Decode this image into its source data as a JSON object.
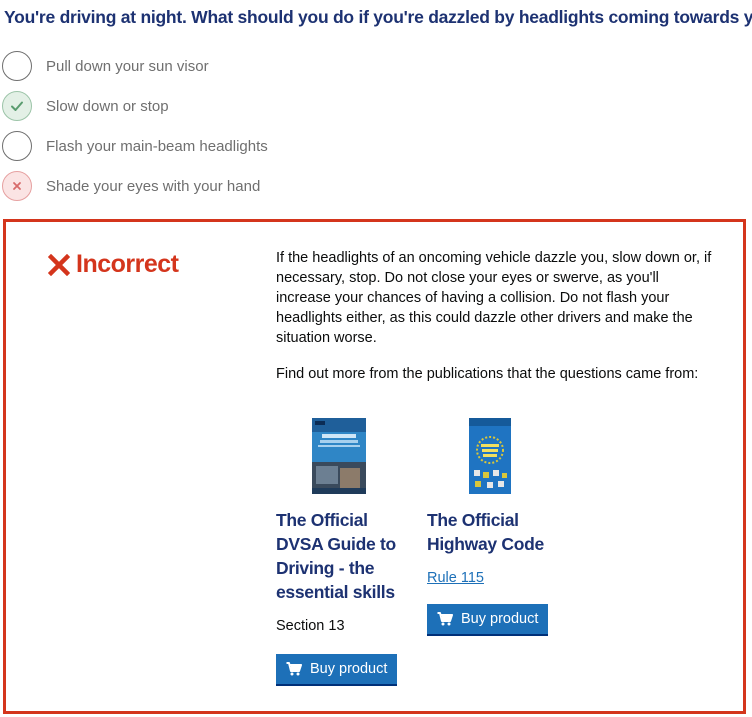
{
  "question": {
    "text": "You're driving at night. What should you do if you're dazzled by headlights coming towards you?"
  },
  "answers": [
    {
      "label": "Pull down your sun visor",
      "state": "none"
    },
    {
      "label": "Slow down or stop",
      "state": "correct"
    },
    {
      "label": "Flash your main-beam headlights",
      "state": "none"
    },
    {
      "label": "Shade your eyes with your hand",
      "state": "selected-wrong"
    }
  ],
  "feedback": {
    "verdict": "Incorrect",
    "verdict_icon": "cross-icon",
    "explanation": "If the headlights of an oncoming vehicle dazzle you, slow down or, if necessary, stop. Do not close your eyes or swerve, as you'll increase your chances of having a collision. Do not flash your headlights either, as this could dazzle other drivers and make the situation worse.",
    "find_out_more": "Find out more from the publications that the questions came from:",
    "publications": [
      {
        "title": "The Official DVSA Guide to Driving - the essential skills",
        "reference": "Section 13",
        "buy_label": "Buy product"
      },
      {
        "title": "The Official Highway Code",
        "reference": "Rule 115",
        "buy_label": "Buy product"
      }
    ]
  },
  "colors": {
    "title": "#1d3272",
    "incorrect": "#d4351c",
    "button": "#1d70b8",
    "link": "#1d70b8",
    "correct_bg": "#e3f0e6",
    "wrong_bg": "#fbe4e4"
  }
}
